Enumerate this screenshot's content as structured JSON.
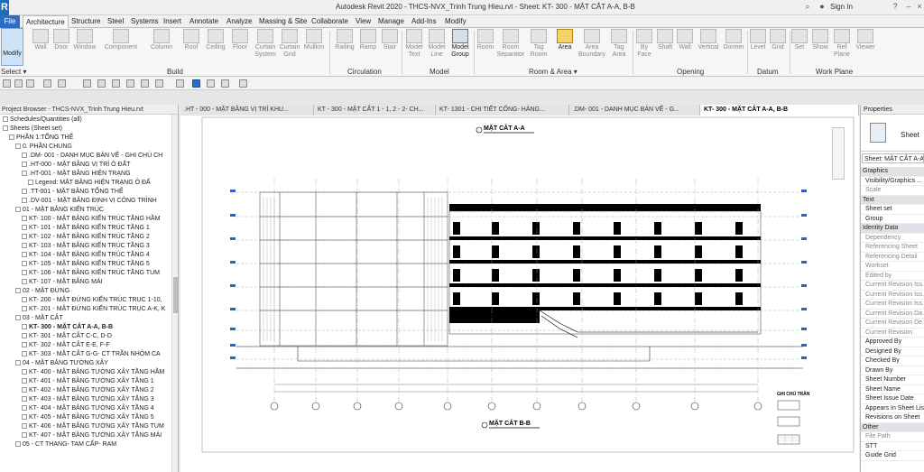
{
  "titlebar": {
    "app_letter": "R",
    "window_title": "Autodesk Revit 2020 - THCS-NVX_Trinh Trung Hieu.rvt - Sheet: KT- 300 - MẶT CẮT A-A, B-B",
    "sign_in": "Sign In"
  },
  "ribbon_tabs": [
    "File",
    "Architecture",
    "Structure",
    "Steel",
    "Systems",
    "Insert",
    "Annotate",
    "Analyze",
    "Massing & Site",
    "Collaborate",
    "View",
    "Manage",
    "Add-Ins",
    "Modify"
  ],
  "ribbon": {
    "modify": "Modify",
    "select": "Select ▾",
    "build": [
      "Wall",
      "Door",
      "Window",
      "Component",
      "Column",
      "Roof",
      "Ceiling",
      "Floor",
      "Curtain System",
      "Curtain Grid",
      "Mullion"
    ],
    "circulation": [
      "Railing",
      "Ramp",
      "Stair"
    ],
    "model": [
      "Model Text",
      "Model Line",
      "Model Group"
    ],
    "room_area": [
      "Room",
      "Room Separator",
      "Tag Room",
      "Area",
      "Area Boundary",
      "Tag Area"
    ],
    "opening": [
      "By Face",
      "Shaft",
      "Wall",
      "Vertical",
      "Dormer"
    ],
    "datum": [
      "Level",
      "Grid"
    ],
    "work_plane": [
      "Set",
      "Show",
      "Ref Plane",
      "Viewer"
    ],
    "panels": [
      "Build",
      "Circulation",
      "Model",
      "Room & Area ▾",
      "Opening",
      "Datum",
      "Work Plane"
    ]
  },
  "project_browser": {
    "header": "Project Browser - THCS-NVX_Trinh Trung Hieu.rvt",
    "items": [
      "Schedules/Quantities (all)",
      "Sheets (Sheet set)",
      "PHẦN 1:TỔNG THỂ",
      "0. PHẦN CHUNG",
      ".DM- 001 - DANH MỤC BẢN VẼ - GHI CHÚ CH",
      ".HT-000 - MẶT BẰNG VỊ TRÍ Ô ĐẤT",
      ".HT-001 - MẶT BẰNG HIỆN TRẠNG",
      "Legend: MẶT BẰNG HIỆN TRẠNG Ô ĐẤ",
      ".TT-001 - MẶT BẰNG TỔNG THỂ",
      ".DV-001 - MẶT BẰNG ĐỊNH VỊ CÔNG TRÌNH",
      "01 - MẶT BẰNG KIẾN TRÚC",
      "KT- 100 - MẶT BẰNG KIẾN TRÚC TẦNG HẦM",
      "KT- 101 - MẶT BẰNG KIẾN TRÚC TẦNG 1",
      "KT- 102 - MẶT BẰNG KIẾN TRÚC TẦNG 2",
      "KT- 103 - MẶT BẰNG KIẾN TRÚC TẦNG 3",
      "KT- 104 - MẶT BẰNG KIẾN TRÚC TẦNG 4",
      "KT- 105 - MẶT BẰNG KIẾN TRÚC TẦNG 5",
      "KT- 106 - MẶT BẰNG KIẾN TRÚC TẦNG TUM",
      "KT- 107 - MẶT BẰNG MÁI",
      "02 - MẶT ĐỨNG",
      "KT- 200 - MẶT ĐỨNG KIẾN TRÚC TRỤC 1-10,",
      "KT- 201 - MẶT ĐỨNG KIẾN TRÚC TRỤC A-K, K",
      "03 - MẶT CẮT",
      "KT- 300 - MẶT CẮT A-A, B-B",
      "KT- 301 - MẶT CẮT C-C, D-D",
      "KT- 302 - MẶT CẮT E-E, F-F",
      "KT- 303 - MẶT CẮT G-G- CT TRẦN NHÔM CA",
      "04 - MẶT BẰNG TƯỜNG XÂY",
      "KT- 400 - MẶT BẰNG TƯỜNG XÂY TẦNG HẦM",
      "KT- 401 - MẶT BẰNG TƯỜNG XÂY TẦNG 1",
      "KT- 402 - MẶT BẰNG TƯỜNG XÂY TẦNG 2",
      "KT- 403 - MẶT BẰNG TƯỜNG XÂY TẦNG 3",
      "KT- 404 - MẶT BẰNG TƯỜNG XÂY TẦNG 4",
      "KT- 405 - MẶT BẰNG TƯỜNG XÂY TẦNG 5",
      "KT- 406 - MẶT BẰNG TƯỜNG XÂY TẦNG TUM",
      "KT- 407 - MẶT BẰNG TƯỜNG XÂY TẦNG MÁI",
      "05 - CT THANG- TAM CẤP- RAM"
    ]
  },
  "view_tabs": [
    ".HT - 000 - MẶT BẰNG VỊ TRÍ KHU...",
    "KT - 300 - MẶT CẮT 1 - 1, 2 - 2- CH...",
    "KT- 1301 - CHI TIẾT CỐNG- HÀNG...",
    ".DM- 001 - DANH MỤC BẢN VẼ - G...",
    "KT- 300 - MẶT CẮT A-A, B-B"
  ],
  "drawing": {
    "section_a": "MẶT CẮT A-A",
    "section_b": "MẶT CẮT B-B",
    "legend_title": "GHI CHÚ TRẦN"
  },
  "properties": {
    "header": "Properties",
    "type_name": "Sheet",
    "selector": "Sheet: MẶT CẮT A-A,",
    "rows": [
      {
        "g": true,
        "t": "Graphics"
      },
      {
        "t": "Visibility/Graphics ..."
      },
      {
        "t": "Scale",
        "d": true
      },
      {
        "g": true,
        "t": "Text"
      },
      {
        "t": "Sheet set"
      },
      {
        "t": "Group"
      },
      {
        "g": true,
        "t": "Identity Data"
      },
      {
        "t": "Dependency",
        "d": true
      },
      {
        "t": "Referencing Sheet",
        "d": true
      },
      {
        "t": "Referencing Detail",
        "d": true
      },
      {
        "t": "Workset",
        "d": true
      },
      {
        "t": "Edited by",
        "d": true
      },
      {
        "t": "Current Revision Iss...",
        "d": true
      },
      {
        "t": "Current Revision Iss...",
        "d": true
      },
      {
        "t": "Current Revision Iss...",
        "d": true
      },
      {
        "t": "Current Revision Da...",
        "d": true
      },
      {
        "t": "Current Revision De...",
        "d": true
      },
      {
        "t": "Current Revision",
        "d": true
      },
      {
        "t": "Approved By"
      },
      {
        "t": "Designed By"
      },
      {
        "t": "Checked By"
      },
      {
        "t": "Drawn By"
      },
      {
        "t": "Sheet Number"
      },
      {
        "t": "Sheet Name"
      },
      {
        "t": "Sheet Issue Date"
      },
      {
        "t": "Appears In Sheet List"
      },
      {
        "t": "Revisions on Sheet"
      },
      {
        "g": true,
        "t": "Other"
      },
      {
        "t": "File Path",
        "d": true
      },
      {
        "t": "STT"
      },
      {
        "t": "Guide Grid"
      }
    ]
  }
}
